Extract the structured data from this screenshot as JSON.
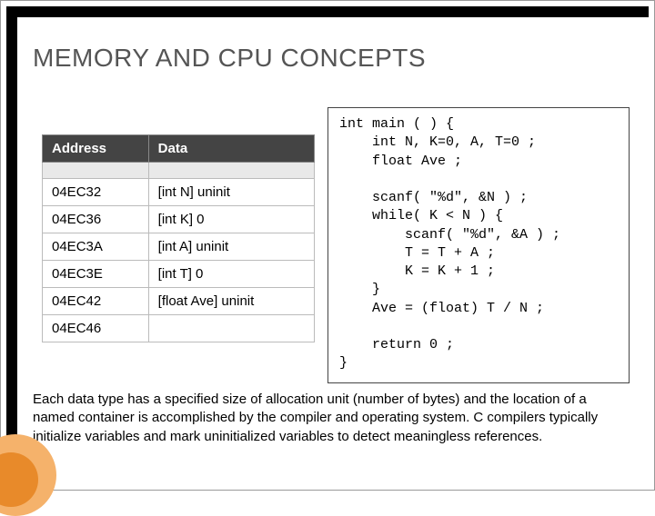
{
  "title": "MEMORY AND CPU CONCEPTS",
  "table": {
    "head": {
      "col0": "Address",
      "col1": "Data"
    },
    "rows": [
      {
        "addr": "04EC32",
        "data": "[int N] uninit"
      },
      {
        "addr": "04EC36",
        "data": "[int K] 0"
      },
      {
        "addr": "04EC3A",
        "data": "[int A] uninit"
      },
      {
        "addr": "04EC3E",
        "data": "[int T] 0"
      },
      {
        "addr": "04EC42",
        "data": "[float Ave] uninit"
      },
      {
        "addr": "04EC46",
        "data": ""
      }
    ]
  },
  "code": "int main ( ) {\n    int N, K=0, A, T=0 ;\n    float Ave ;\n\n    scanf( \"%d\", &N ) ;\n    while( K < N ) {\n        scanf( \"%d\", &A ) ;\n        T = T + A ;\n        K = K + 1 ;\n    }\n    Ave = (float) T / N ;\n\n    return 0 ;\n}",
  "body": "Each data type has a specified size of allocation unit (number of bytes) and the location of a named container is accomplished by the compiler and operating system.  C compilers typically initialize variables and mark uninitialized variables to detect meaningless references."
}
